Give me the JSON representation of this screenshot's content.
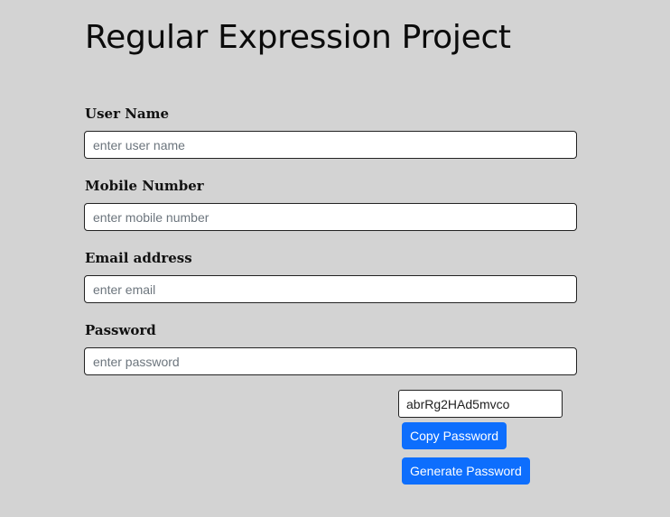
{
  "header": {
    "title": "Regular Expression Project"
  },
  "form": {
    "username": {
      "label": "User Name",
      "placeholder": "enter user name",
      "value": ""
    },
    "mobile": {
      "label": "Mobile Number",
      "placeholder": "enter mobile number",
      "value": ""
    },
    "email": {
      "label": "Email address",
      "placeholder": "enter email",
      "value": ""
    },
    "password": {
      "label": "Password",
      "placeholder": "enter password",
      "value": ""
    }
  },
  "generator": {
    "generated_password": "abrRg2HAd5mvco",
    "copy_label": "Copy Password",
    "generate_label": "Generate Password"
  },
  "colors": {
    "background": "#d3d3d3",
    "button_primary": "#0d6efd"
  }
}
